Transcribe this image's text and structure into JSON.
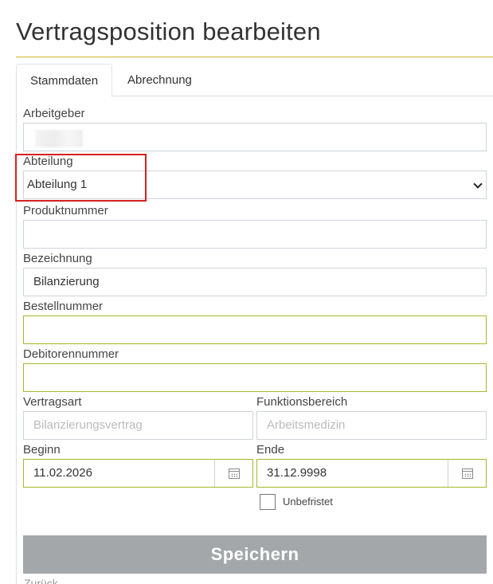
{
  "page": {
    "title": "Vertragsposition bearbeiten"
  },
  "tabs": [
    {
      "label": "Stammdaten",
      "active": true
    },
    {
      "label": "Abrechnung",
      "active": false
    }
  ],
  "form": {
    "arbeitgeber": {
      "label": "Arbeitgeber",
      "value": ""
    },
    "abteilung": {
      "label": "Abteilung",
      "value": "Abteilung 1"
    },
    "produktnummer": {
      "label": "Produktnummer",
      "value": ""
    },
    "bezeichnung": {
      "label": "Bezeichnung",
      "value": "Bilanzierung"
    },
    "bestellnummer": {
      "label": "Bestellnummer",
      "value": ""
    },
    "debitorennummer": {
      "label": "Debitorennummer",
      "value": ""
    },
    "vertragsart": {
      "label": "Vertragsart",
      "value": "Bilanzierungsvertrag"
    },
    "funktionsbereich": {
      "label": "Funktionsbereich",
      "value": "Arbeitsmedizin"
    },
    "beginn": {
      "label": "Beginn",
      "value": "11.02.2026"
    },
    "ende": {
      "label": "Ende",
      "value": "31.12.9998"
    },
    "unbefristet": {
      "label": "Unbefristet",
      "checked": false
    }
  },
  "actions": {
    "save_label": "Speichern",
    "back_label": "Zurück"
  },
  "colors": {
    "accent_rule": "#c8b92a",
    "required_border": "#a8b82a",
    "highlight": "#d62020",
    "save_button": "#a3a7aa"
  },
  "icons": {
    "date_picker": "calendar-icon",
    "select": "chevron-down-icon"
  }
}
